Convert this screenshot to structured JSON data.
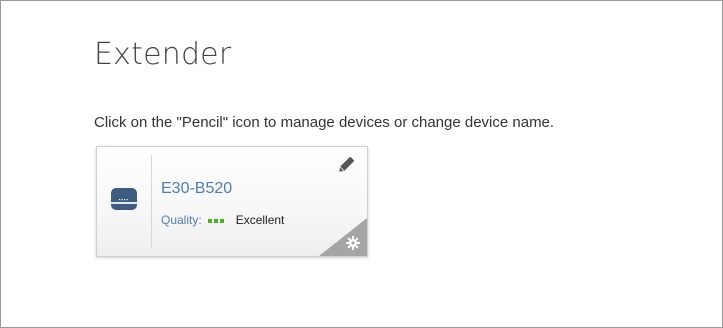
{
  "page": {
    "title": "Extender",
    "instruction": "Click on the \"Pencil\" icon to manage devices or change device name."
  },
  "device_card": {
    "device_name": "E30-B520",
    "quality_label": "Quality:",
    "quality_value": "Excellent",
    "signal_bars_lit": 3,
    "signal_bars_total": 3,
    "icons": {
      "device": "extender-device-icon",
      "edit": "pencil-icon",
      "settings": "gear-icon"
    }
  },
  "colors": {
    "link_blue": "#4f7cae",
    "signal_green": "#4caf2a",
    "device_icon": "#3d5c80",
    "corner_gray": "#a5a5a5"
  }
}
